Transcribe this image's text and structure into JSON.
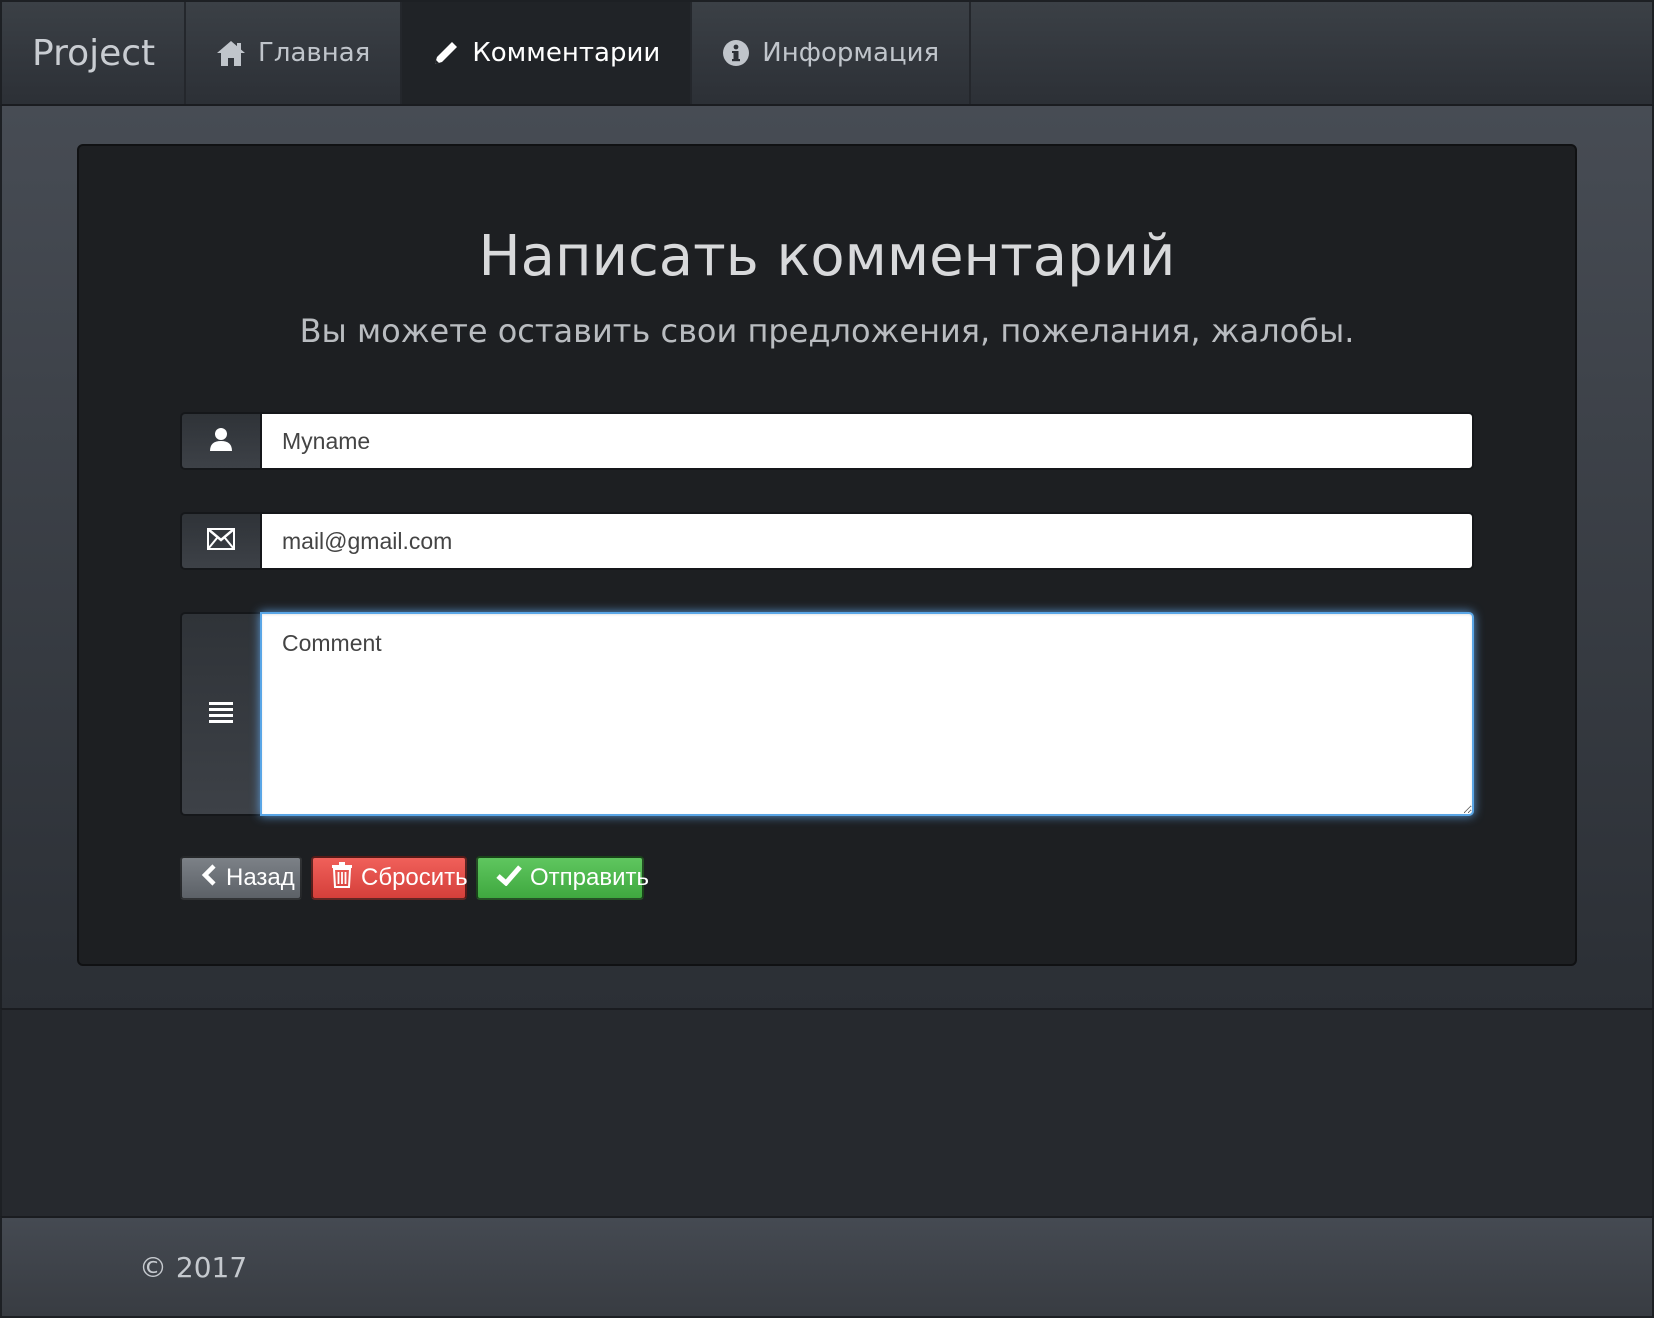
{
  "navbar": {
    "brand": "Project",
    "items": [
      {
        "label": "Главная",
        "icon": "home-icon",
        "active": false
      },
      {
        "label": "Комментарии",
        "icon": "pencil-icon",
        "active": true
      },
      {
        "label": "Информация",
        "icon": "info-icon",
        "active": false
      }
    ]
  },
  "form": {
    "title": "Написать комментарий",
    "subtitle": "Вы можете оставить свои предложения, пожелания, жалобы.",
    "name_placeholder": "Myname",
    "email_placeholder": "mail@gmail.com",
    "comment_placeholder": "Comment",
    "buttons": {
      "back": "Назад",
      "reset": "Сбросить",
      "send": "Отправить"
    }
  },
  "footer": {
    "copyright": "© 2017"
  },
  "colors": {
    "reset_button": "#d9534f",
    "send_button": "#4cae4c",
    "back_button": "#6b7076",
    "focus_glow": "#5aa6e6"
  }
}
